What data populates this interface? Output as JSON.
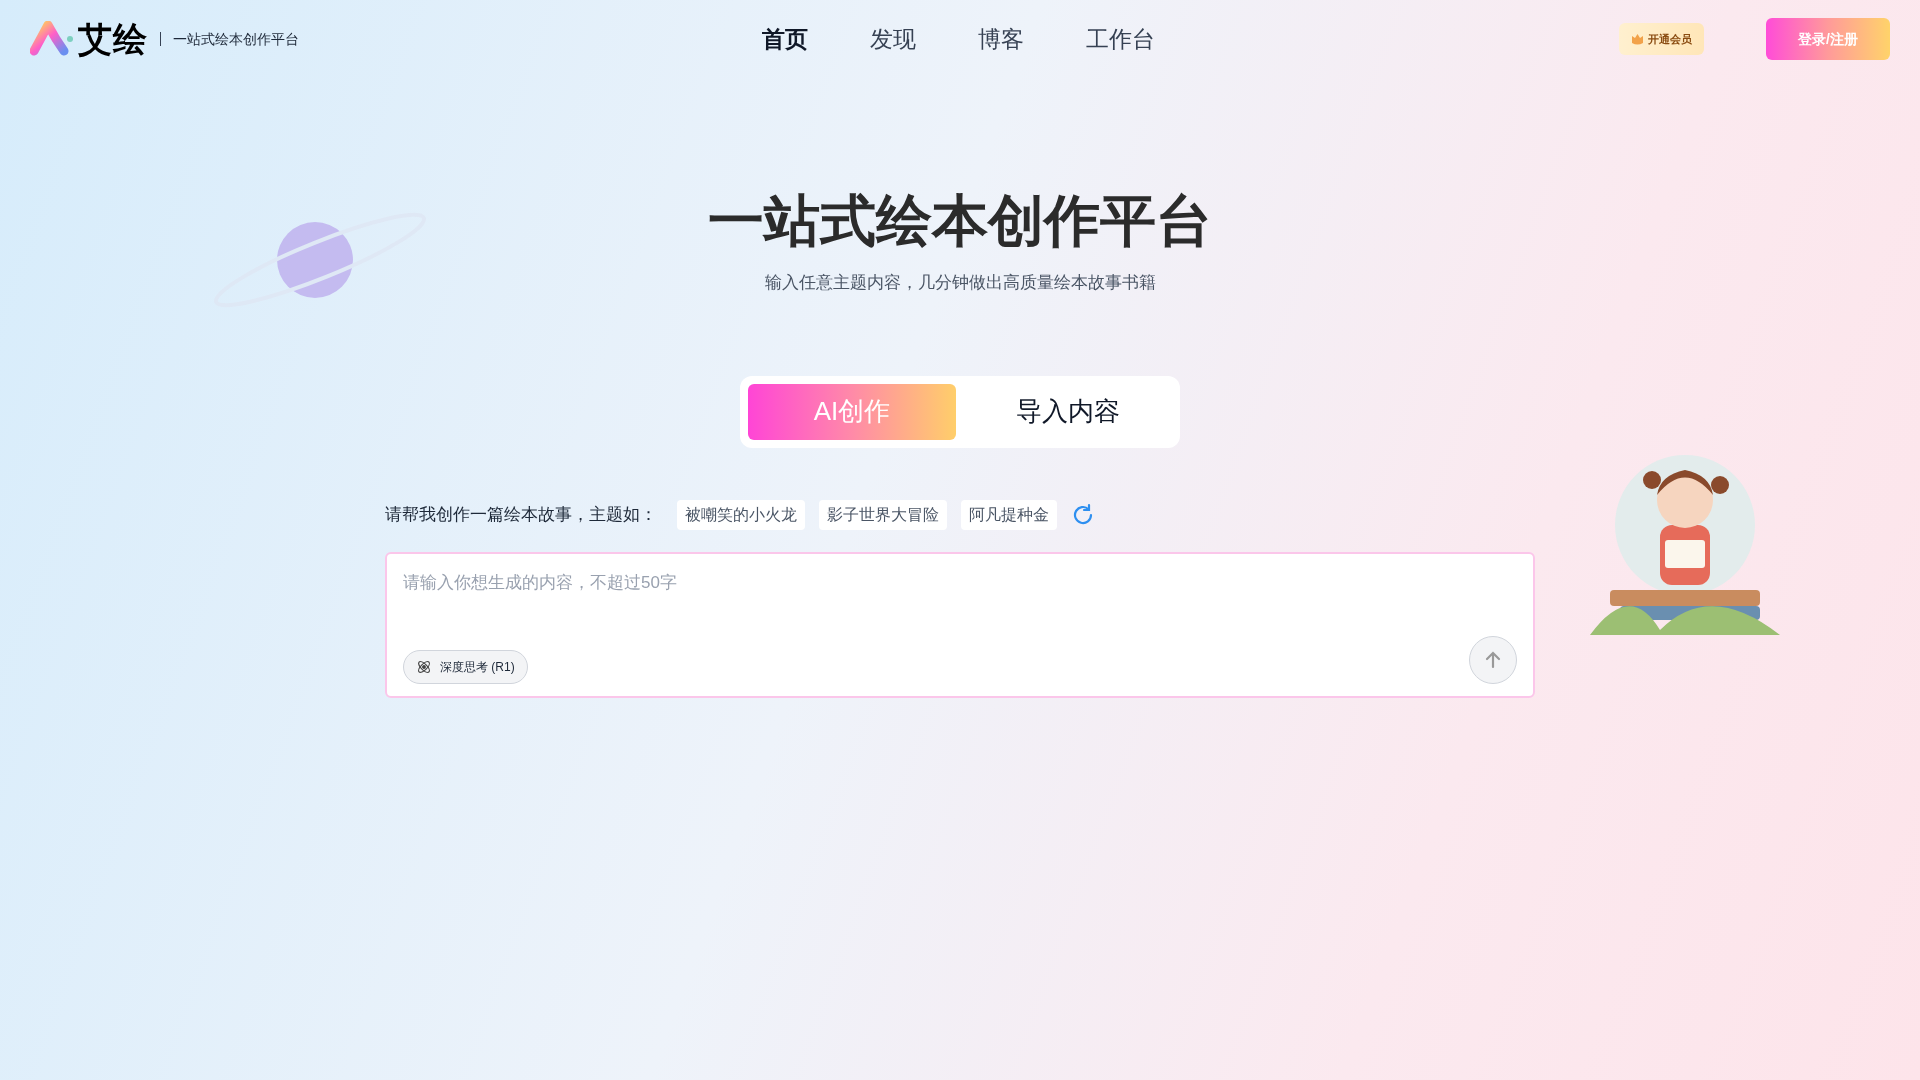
{
  "header": {
    "logo_text": "艾绘",
    "tagline": "一站式绘本创作平台",
    "nav": [
      {
        "label": "首页",
        "selected": true
      },
      {
        "label": "发现",
        "selected": false
      },
      {
        "label": "博客",
        "selected": false
      },
      {
        "label": "工作台",
        "selected": false
      }
    ],
    "vip_button": "开通会员",
    "login_button": "登录/注册"
  },
  "hero": {
    "title": "一站式绘本创作平台",
    "subtitle": "输入任意主题内容，几分钟做出高质量绘本故事书籍"
  },
  "mode_tabs": [
    {
      "label": "AI创作",
      "selected": true
    },
    {
      "label": "导入内容",
      "selected": false
    }
  ],
  "prompt": {
    "label": "请帮我创作一篇绘本故事，主题如：",
    "suggestions": [
      "被嘲笑的小火龙",
      "影子世界大冒险",
      "阿凡提种金"
    ],
    "placeholder": "请输入你想生成的内容，不超过50字",
    "deep_think": "深度思考 (R1)"
  }
}
